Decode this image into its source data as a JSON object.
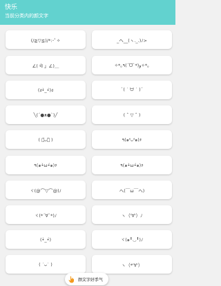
{
  "header": {
    "title": "快乐",
    "subtitle": "当前分类内的颜文字"
  },
  "kaomoji": [
    "(/≧▽≦)/*:･ﾟ✧",
    "_ヘ__(ヽ._.)ﾉ>",
    "∠( ᐛ 」∠)＿",
    "✧*｡٩(ˊᗜˋ*)و✧*｡",
    "(ง•̀_•́)ง",
    "ˋ( ˙ ᗨ ˙ )ˊ",
    "╲(´●ᴥ●`)╱",
    "( ˆ ▽ ˆ )",
    "( ･᷄ᴗ･᷅ )",
    "٩(๑❛ᴗ❛๑)۶",
    "٩(๑•̀ω•́๑)۶",
    "٩(๑•̀ω•́๑)۶",
    "ヾ(@⌒▽⌒@)ﾉ",
    "ヘ(￣ω￣ヘ)",
    "ヾ(*´∀`*)ﾉ",
    "ヽ（'∀'）ﾉ",
    "(•̀_•́)",
    "ヾ(๑╹◡╹)ﾉ",
    "( ˙ᴗ˙ )",
    "ヽ（*'∀'）"
  ],
  "fab": {
    "label": "颜文字好手气",
    "icon": "hand-icon"
  }
}
